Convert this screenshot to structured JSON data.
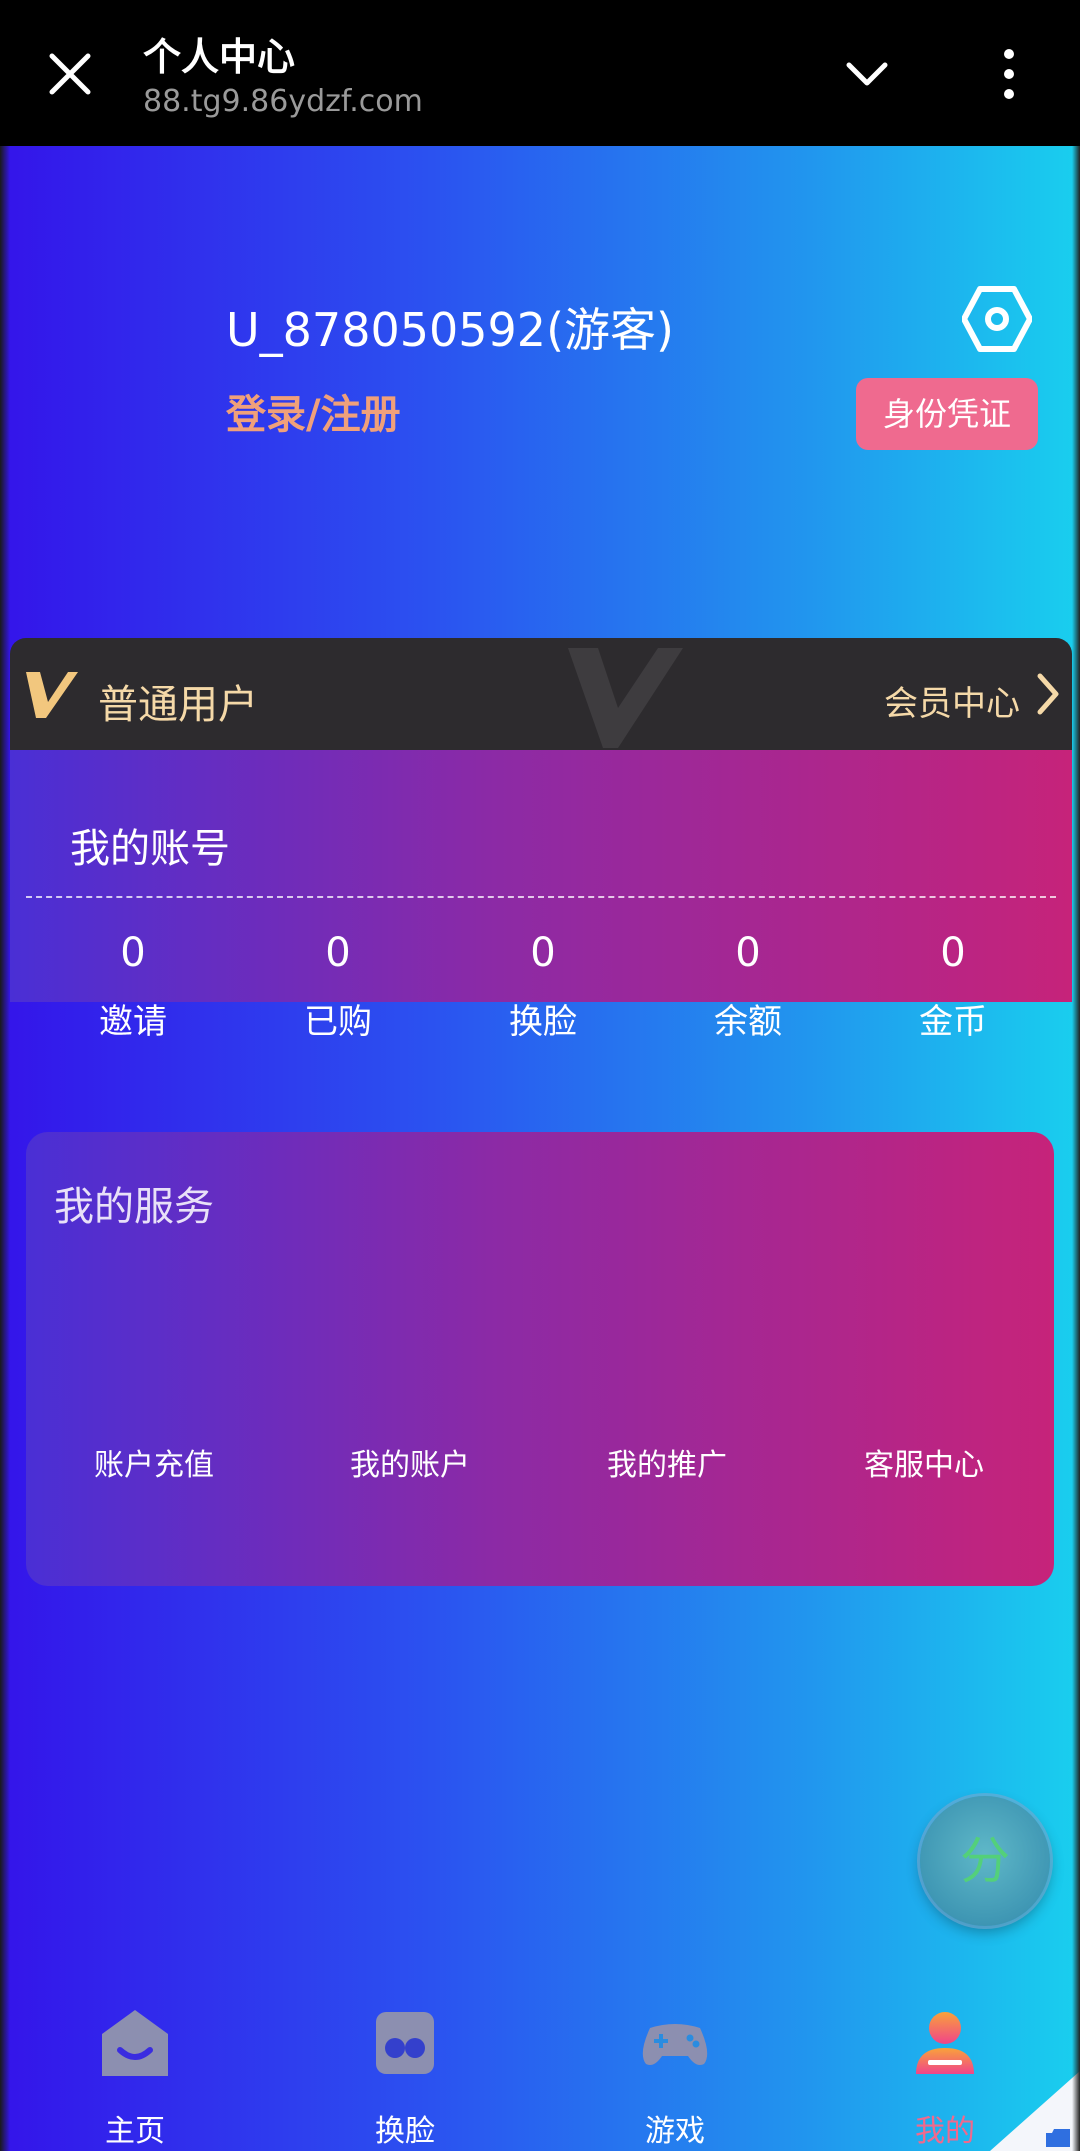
{
  "browser": {
    "title": "个人中心",
    "url": "88.tg9.86ydzf.com"
  },
  "profile": {
    "username": "U_878050592(游客)",
    "login_label": "登录/注册",
    "identity_button": "身份凭证"
  },
  "vip": {
    "level": "普通用户",
    "center_link": "会员中心"
  },
  "account": {
    "heading": "我的账号",
    "stats": [
      {
        "value": "0",
        "label": "邀请"
      },
      {
        "value": "0",
        "label": "已购"
      },
      {
        "value": "0",
        "label": "换脸"
      },
      {
        "value": "0",
        "label": "余额"
      },
      {
        "value": "0",
        "label": "金币"
      }
    ]
  },
  "services": {
    "heading": "我的服务",
    "items": [
      {
        "label": "账户充值"
      },
      {
        "label": "我的账户"
      },
      {
        "label": "我的推广"
      },
      {
        "label": "客服中心"
      }
    ]
  },
  "share_button": "分",
  "tabbar": {
    "active": "我的",
    "items": [
      {
        "label": "主页",
        "icon": "home-icon"
      },
      {
        "label": "换脸",
        "icon": "faceswap-icon"
      },
      {
        "label": "游戏",
        "icon": "gamepad-icon"
      },
      {
        "label": "我的",
        "icon": "user-icon"
      }
    ]
  },
  "colors": {
    "accent_pink": "#ef6a8f",
    "login_orange": "#f0a07a",
    "vip_gold": "#f5d9a8"
  }
}
